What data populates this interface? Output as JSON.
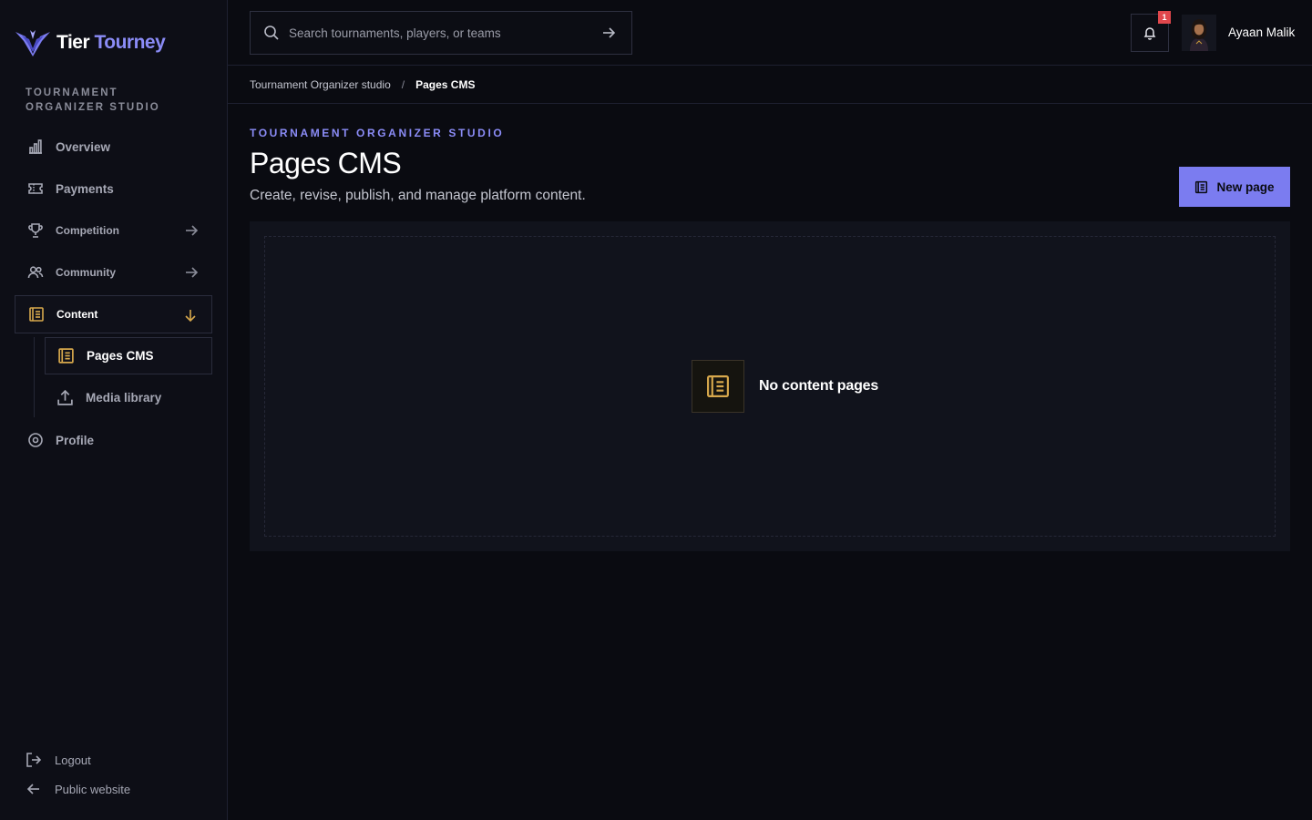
{
  "brand": {
    "name_part1": "Tier",
    "name_part2": "Tourney"
  },
  "sidebar": {
    "section_title": "TOURNAMENT ORGANIZER STUDIO",
    "items": [
      {
        "label": "Overview",
        "icon": "bar-chart-icon"
      },
      {
        "label": "Payments",
        "icon": "ticket-icon"
      },
      {
        "label": "Competition",
        "icon": "trophy-icon",
        "arrow": "arrow-right-icon"
      },
      {
        "label": "Community",
        "icon": "users-icon",
        "arrow": "arrow-right-icon"
      },
      {
        "label": "Content",
        "icon": "document-list-icon",
        "arrow": "arrow-down-icon",
        "expanded": true
      },
      {
        "label": "Profile",
        "icon": "gear-icon"
      }
    ],
    "subitems": [
      {
        "label": "Pages CMS",
        "icon": "document-list-icon",
        "active": true
      },
      {
        "label": "Media library",
        "icon": "upload-icon"
      }
    ],
    "footer": {
      "logout": "Logout",
      "public_website": "Public website"
    }
  },
  "topbar": {
    "search_placeholder": "Search tournaments, players, or teams",
    "notification_count": "1",
    "user_name": "Ayaan Malik"
  },
  "breadcrumb": {
    "parent": "Tournament Organizer studio",
    "separator": "/",
    "current": "Pages CMS"
  },
  "main": {
    "eyebrow": "TOURNAMENT ORGANIZER STUDIO",
    "title": "Pages CMS",
    "subtitle": "Create, revise, publish, and manage platform content.",
    "new_button": "New page",
    "empty_state": "No content pages"
  },
  "colors": {
    "accent": "#7b7cf0",
    "accent_text": "#8b8cf7",
    "gold": "#d7a84c",
    "badge": "#e0474c",
    "background": "#0a0b11"
  }
}
